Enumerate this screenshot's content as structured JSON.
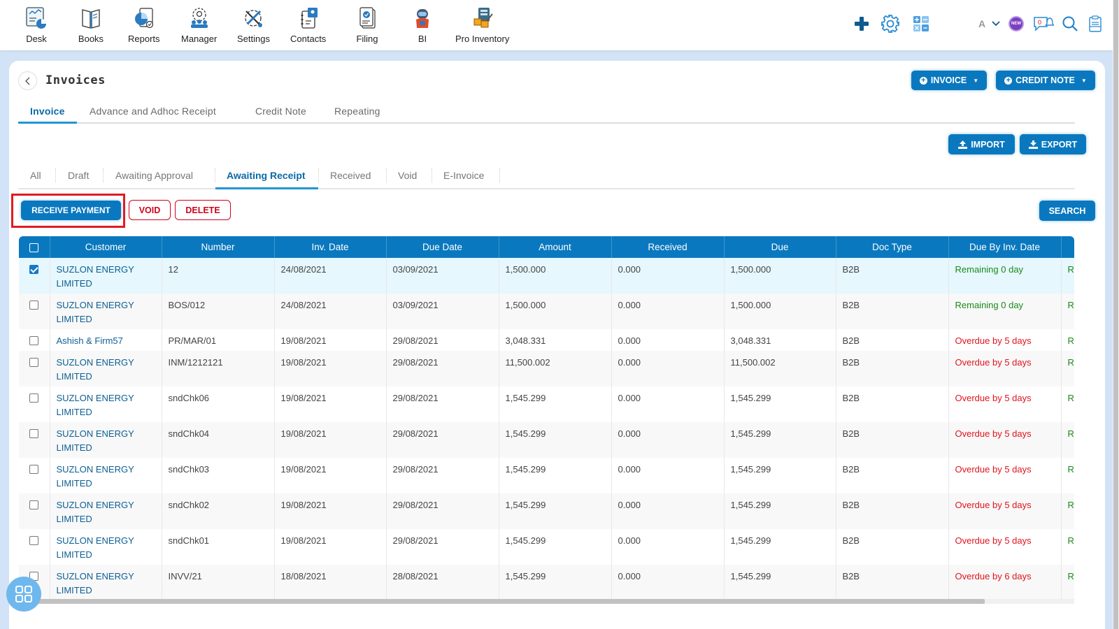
{
  "nav": {
    "items": [
      {
        "label": "Desk",
        "icon": "desk-icon"
      },
      {
        "label": "Books",
        "icon": "books-icon"
      },
      {
        "label": "Reports",
        "icon": "reports-icon"
      },
      {
        "label": "Manager",
        "icon": "manager-icon"
      },
      {
        "label": "Settings",
        "icon": "settings-tools-icon"
      },
      {
        "label": "Contacts",
        "icon": "contacts-icon"
      },
      {
        "label": "Filing",
        "icon": "filing-icon"
      },
      {
        "label": "BI",
        "icon": "bi-robot-icon"
      },
      {
        "label": "Pro Inventory",
        "icon": "pro-inventory-icon"
      }
    ],
    "right": {
      "font_size_label": "A",
      "new_badge": "NEW",
      "notification_count": "0"
    }
  },
  "page": {
    "title": "Invoices",
    "buttons": {
      "invoice": "INVOICE",
      "credit_note": "CREDIT NOTE",
      "import": "IMPORT",
      "export": "EXPORT",
      "receive_payment": "RECEIVE PAYMENT",
      "void": "VOID",
      "delete": "DELETE",
      "search": "SEARCH"
    },
    "main_tabs": [
      "Invoice",
      "Advance and Adhoc Receipt",
      "Credit Note",
      "Repeating"
    ],
    "active_main_tab": "Invoice",
    "sub_tabs": [
      "All",
      "Draft",
      "Awaiting Approval",
      "Awaiting Receipt",
      "Received",
      "Void",
      "E-Invoice"
    ],
    "active_sub_tab": "Awaiting Receipt"
  },
  "colors": {
    "primary": "#0a78bf",
    "danger": "#d0021b",
    "success": "#1a8a1a",
    "highlight": "#e11b22"
  },
  "table": {
    "columns": [
      "Customer",
      "Number",
      "Inv. Date",
      "Due Date",
      "Amount",
      "Received",
      "Due",
      "Doc Type",
      "Due By Inv. Date",
      ""
    ],
    "rows": [
      {
        "selected": true,
        "customer": "SUZLON ENERGY LIMITED",
        "number": "12",
        "inv_date": "24/08/2021",
        "due_date": "03/09/2021",
        "amount": "1,500.000",
        "received": "0.000",
        "due": "1,500.000",
        "doc_type": "B2B",
        "due_by": "Remaining 0 day",
        "status": "ok",
        "extra": "Re"
      },
      {
        "selected": false,
        "customer": "SUZLON ENERGY LIMITED",
        "number": "BOS/012",
        "inv_date": "24/08/2021",
        "due_date": "03/09/2021",
        "amount": "1,500.000",
        "received": "0.000",
        "due": "1,500.000",
        "doc_type": "B2B",
        "due_by": "Remaining 0 day",
        "status": "ok",
        "extra": "Re"
      },
      {
        "selected": false,
        "customer": "Ashish & Firm57",
        "number": "PR/MAR/01",
        "inv_date": "19/08/2021",
        "due_date": "29/08/2021",
        "amount": "3,048.331",
        "received": "0.000",
        "due": "3,048.331",
        "doc_type": "B2B",
        "due_by": "Overdue by 5 days",
        "status": "overdue",
        "extra": "Re"
      },
      {
        "selected": false,
        "customer": "SUZLON ENERGY LIMITED",
        "number": "INM/1212121",
        "inv_date": "19/08/2021",
        "due_date": "29/08/2021",
        "amount": "11,500.002",
        "received": "0.000",
        "due": "11,500.002",
        "doc_type": "B2B",
        "due_by": "Overdue by 5 days",
        "status": "overdue",
        "extra": "Re"
      },
      {
        "selected": false,
        "customer": "SUZLON ENERGY LIMITED",
        "number": "sndChk06",
        "inv_date": "19/08/2021",
        "due_date": "29/08/2021",
        "amount": "1,545.299",
        "received": "0.000",
        "due": "1,545.299",
        "doc_type": "B2B",
        "due_by": "Overdue by 5 days",
        "status": "overdue",
        "extra": "Re"
      },
      {
        "selected": false,
        "customer": "SUZLON ENERGY LIMITED",
        "number": "sndChk04",
        "inv_date": "19/08/2021",
        "due_date": "29/08/2021",
        "amount": "1,545.299",
        "received": "0.000",
        "due": "1,545.299",
        "doc_type": "B2B",
        "due_by": "Overdue by 5 days",
        "status": "overdue",
        "extra": "Re"
      },
      {
        "selected": false,
        "customer": "SUZLON ENERGY LIMITED",
        "number": "sndChk03",
        "inv_date": "19/08/2021",
        "due_date": "29/08/2021",
        "amount": "1,545.299",
        "received": "0.000",
        "due": "1,545.299",
        "doc_type": "B2B",
        "due_by": "Overdue by 5 days",
        "status": "overdue",
        "extra": "Re"
      },
      {
        "selected": false,
        "customer": "SUZLON ENERGY LIMITED",
        "number": "sndChk02",
        "inv_date": "19/08/2021",
        "due_date": "29/08/2021",
        "amount": "1,545.299",
        "received": "0.000",
        "due": "1,545.299",
        "doc_type": "B2B",
        "due_by": "Overdue by 5 days",
        "status": "overdue",
        "extra": "Re"
      },
      {
        "selected": false,
        "customer": "SUZLON ENERGY LIMITED",
        "number": "sndChk01",
        "inv_date": "19/08/2021",
        "due_date": "29/08/2021",
        "amount": "1,545.299",
        "received": "0.000",
        "due": "1,545.299",
        "doc_type": "B2B",
        "due_by": "Overdue by 5 days",
        "status": "overdue",
        "extra": "Re"
      },
      {
        "selected": false,
        "customer": "SUZLON ENERGY LIMITED",
        "number": "INVV/21",
        "inv_date": "18/08/2021",
        "due_date": "28/08/2021",
        "amount": "1,545.299",
        "received": "0.000",
        "due": "1,545.299",
        "doc_type": "B2B",
        "due_by": "Overdue by 6 days",
        "status": "overdue",
        "extra": "Re"
      }
    ]
  }
}
